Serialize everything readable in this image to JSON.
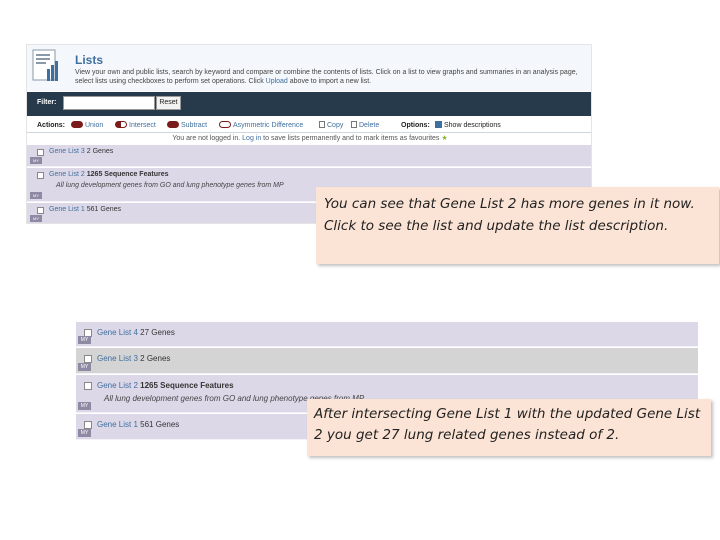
{
  "screenshot1": {
    "title": "Lists",
    "description_parts": [
      "View your own and public lists, search by keyword and compare or combine the contents of lists. Click on a list to view graphs and summaries in an analysis page, select lists using checkboxes to perform set operations. Click ",
      "Upload",
      " above to import a new list."
    ],
    "filter_label": "Filter:",
    "filter_value": "",
    "reset_label": "Reset",
    "actions_label": "Actions:",
    "actions": [
      "Union",
      "Intersect",
      "Subtract",
      "Asymmetric Difference",
      "Copy",
      "Delete"
    ],
    "options_label": "Options:",
    "show_descriptions": "Show descriptions",
    "notice_parts": [
      "You are not logged in. ",
      "Log in",
      " to save lists permanently and to mark items as favourites"
    ],
    "rows": [
      {
        "name": "Gene List 3",
        "count": "2 Genes",
        "subtitle": ""
      },
      {
        "name": "Gene List 2",
        "count": "1265 Sequence Features",
        "subtitle": "All lung development genes from GO and lung phenotype genes from MP"
      },
      {
        "name": "Gene List 1",
        "count": "561 Genes",
        "subtitle": ""
      }
    ],
    "my_badge": "MY"
  },
  "screenshot2": {
    "rows": [
      {
        "name": "Gene List 4",
        "count": "27 Genes",
        "subtitle": ""
      },
      {
        "name": "Gene List 3",
        "count": "2 Genes",
        "subtitle": ""
      },
      {
        "name": "Gene List 2",
        "count": "1265 Sequence Features",
        "subtitle": "All lung development genes from GO and lung phenotype genes from MP"
      },
      {
        "name": "Gene List 1",
        "count": "561 Genes",
        "subtitle": ""
      }
    ],
    "my_badge": "MY"
  },
  "callout1": "You can see that Gene List 2 has more genes in it now. Click to see the list and update the list description.",
  "callout2": "After intersecting Gene List 1 with the updated Gene List 2 you get 27 lung related genes instead of 2.",
  "colors": {
    "header_bar": "#263a4c",
    "row_bg": "#ddd8e8",
    "row_bg_grey": "#d4d4d4",
    "link": "#3f6f9e",
    "callout_bg": "#fbe4d5"
  }
}
